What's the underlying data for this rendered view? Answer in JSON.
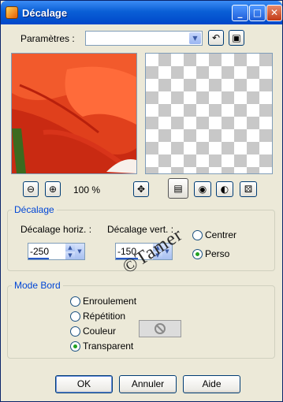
{
  "window": {
    "title": "Décalage",
    "controls": {
      "minimize": "_",
      "maximize": "□",
      "close": "✕"
    }
  },
  "params": {
    "label": "Paramètres :",
    "value": ""
  },
  "zoom": {
    "level_text": "100 %"
  },
  "offset_group": {
    "title": "Décalage",
    "horizontal": {
      "label": "Décalage horiz. :",
      "value": "-250"
    },
    "vertical": {
      "label": "Décalage vert. :",
      "value": "-150"
    },
    "options": [
      {
        "label": "Centrer",
        "selected": false
      },
      {
        "label": "Perso",
        "selected": true
      }
    ]
  },
  "edge_group": {
    "title": "Mode Bord",
    "options": [
      {
        "label": "Enroulement",
        "selected": false
      },
      {
        "label": "Répétition",
        "selected": false
      },
      {
        "label": "Couleur",
        "selected": false
      },
      {
        "label": "Transparent",
        "selected": true
      }
    ]
  },
  "watermark": "©Tamer",
  "buttons": {
    "ok": "OK",
    "cancel": "Annuler",
    "help": "Aide"
  },
  "colors": {
    "accent": "#0046d5",
    "title_bar": "#0a5fd6",
    "radio_selected": "#21a121"
  }
}
